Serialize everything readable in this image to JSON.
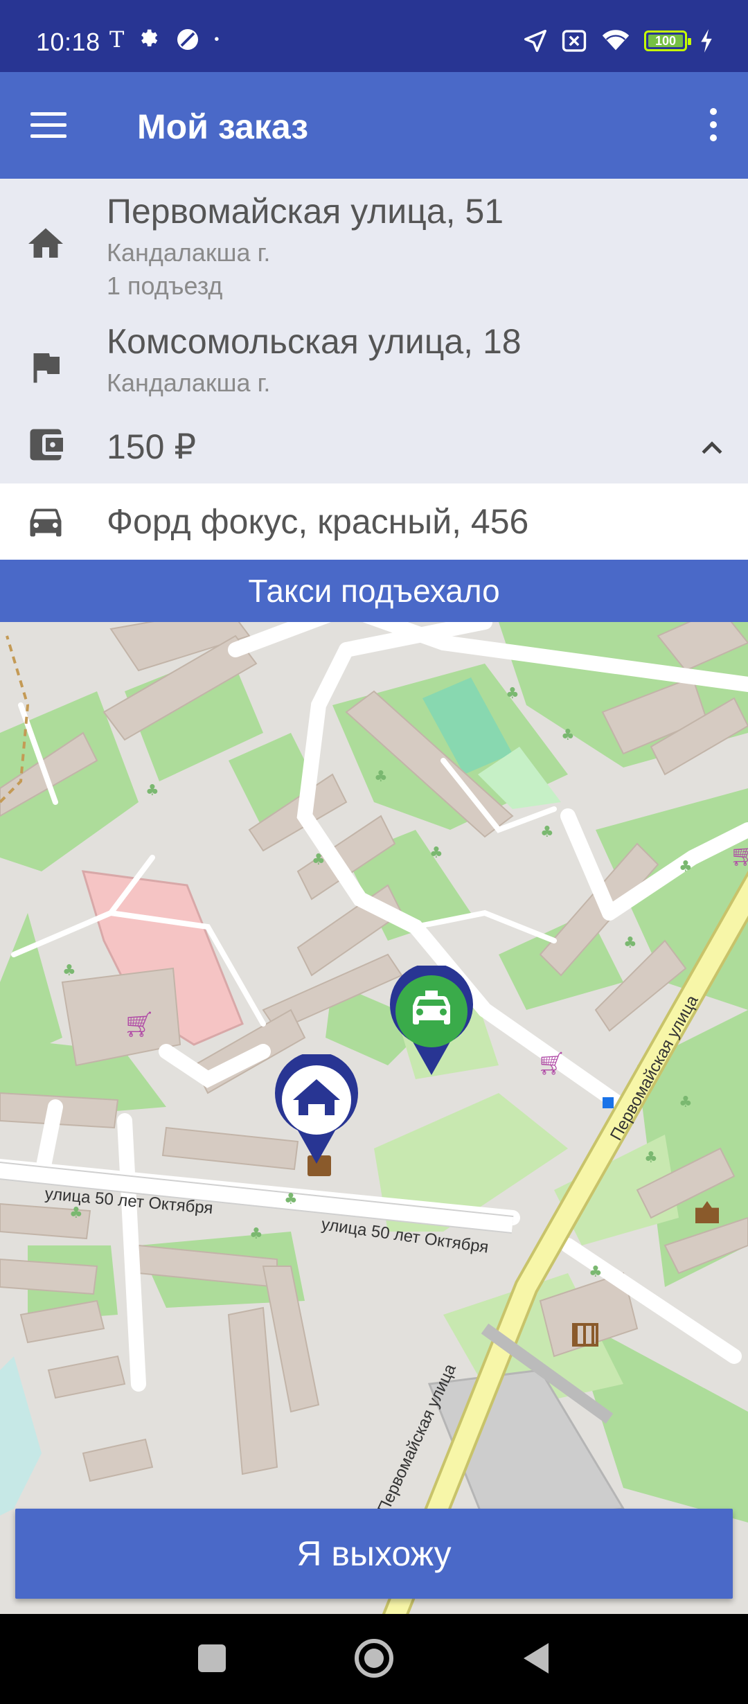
{
  "status_bar": {
    "time": "10:18",
    "left_icons": [
      "carrier-t-icon",
      "gear-icon",
      "moon-icon",
      "dot-icon"
    ],
    "carrier_glyph": "T",
    "right_icons": [
      "location-arrow-icon",
      "sim-off-icon",
      "wifi-icon",
      "battery-icon",
      "charging-icon"
    ],
    "battery_level": "100"
  },
  "app_bar": {
    "title": "Мой заказ",
    "menu_icon": "hamburger-icon",
    "overflow_icon": "more-vert-icon"
  },
  "order": {
    "pickup": {
      "icon": "home-icon",
      "address": "Первомайская улица, 51",
      "city": "Кандалакша г.",
      "entrance": "1 подъезд"
    },
    "destination": {
      "icon": "flag-icon",
      "address": "Комсомольская улица, 18",
      "city": "Кандалакша г."
    },
    "price": {
      "icon": "wallet-icon",
      "value": "150 ₽",
      "toggle_icon": "chevron-up-icon"
    },
    "car": {
      "icon": "car-icon",
      "description": "Форд фокус, красный, 456"
    }
  },
  "status_banner": "Такси подъехало",
  "map": {
    "street_labels": [
      "улица 50 лет Октября",
      "улица 50 лет Октября",
      "Первомайская улица",
      "Первомайская улица"
    ],
    "markers": [
      "taxi-marker-icon",
      "home-marker-icon"
    ],
    "colors": {
      "taxi_marker": "#3aab4a",
      "home_marker": "#283593"
    }
  },
  "primary_action": "Я выхожу",
  "nav_bar": [
    "recents-icon",
    "home-nav-icon",
    "back-icon"
  ],
  "colors": {
    "status_bar": "#283593",
    "accent": "#4a69c8",
    "panel_bg": "#e8eaf2"
  }
}
